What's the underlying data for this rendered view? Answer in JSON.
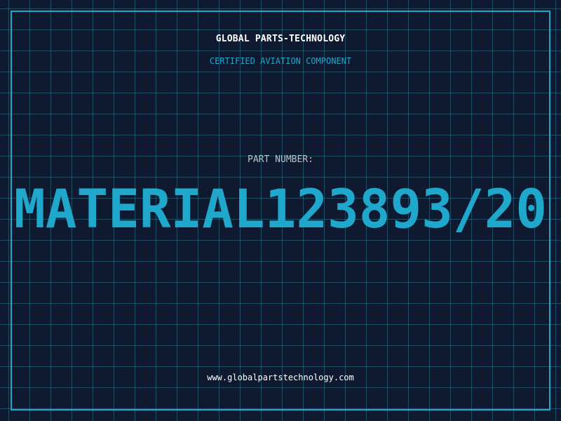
{
  "header": {
    "company": "GLOBAL PARTS-TECHNOLOGY",
    "tagline": "CERTIFIED AVIATION COMPONENT"
  },
  "part": {
    "label": "PART NUMBER:",
    "number": "MATERIAL123893/20"
  },
  "footer": {
    "url": "www.globalpartstechnology.com"
  },
  "colors": {
    "background": "#0f1a30",
    "grid": "#28788c",
    "accent": "#1fa8cc",
    "text": "#ffffff",
    "label": "#b8c2cc"
  }
}
